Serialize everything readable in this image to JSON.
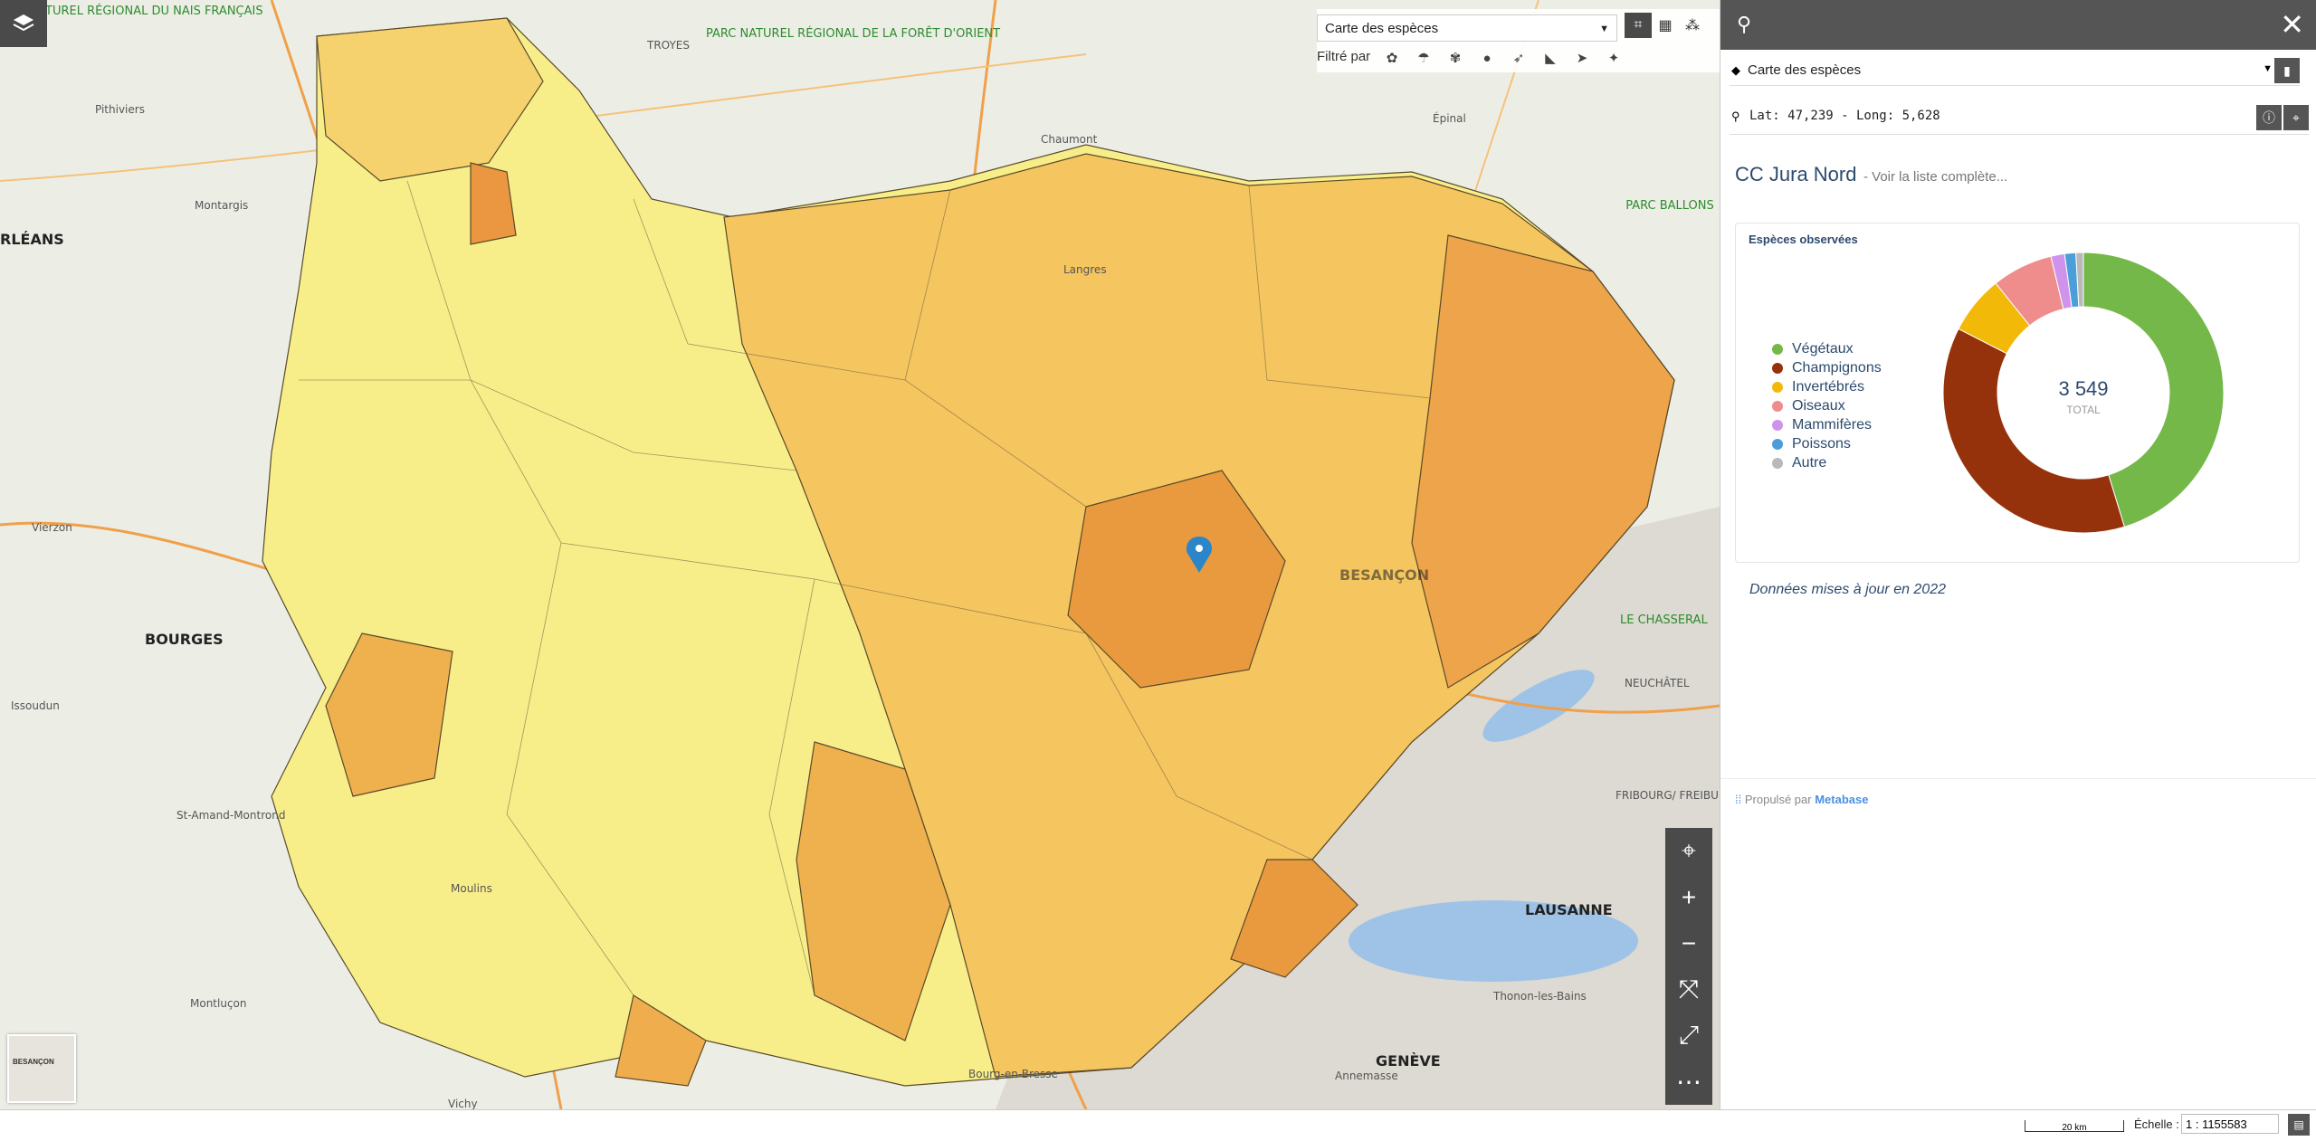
{
  "map": {
    "labels": [
      {
        "name": "label-parc-foret-orient",
        "text": "PARC NATUREL RÉGIONAL DE LA FORÊT D'ORIENT",
        "type": "park"
      },
      {
        "name": "label-parc-morvan",
        "text": "TUREL RÉGIONAL DU NAIS FRANÇAIS",
        "type": "park"
      },
      {
        "name": "label-parc-ballons",
        "text": "PARC BALLONS",
        "type": "park"
      },
      {
        "name": "label-le-chasseral",
        "text": "LE CHASSERAL",
        "type": "park"
      },
      {
        "name": "label-orleans",
        "text": "RLÉANS",
        "type": "big"
      },
      {
        "name": "label-bourges",
        "text": "BOURGES",
        "type": "big"
      },
      {
        "name": "label-lausanne",
        "text": "LAUSANNE",
        "type": "big"
      },
      {
        "name": "label-geneve",
        "text": "GENÈVE",
        "type": "big"
      },
      {
        "name": "label-besancon",
        "text": "BESANÇON",
        "type": "big"
      },
      {
        "name": "label-neuchatel",
        "text": "NEUCHÂTEL",
        "type": "city"
      },
      {
        "name": "label-troyes",
        "text": "TROYES",
        "type": "city"
      },
      {
        "name": "label-chaumont",
        "text": "Chaumont",
        "type": "city"
      },
      {
        "name": "label-epinal",
        "text": "Épinal",
        "type": "city"
      },
      {
        "name": "label-vierzon",
        "text": "Vierzon",
        "type": "city"
      },
      {
        "name": "label-issoudun",
        "text": "Issoudun",
        "type": "city"
      },
      {
        "name": "label-st-amand",
        "text": "St-Amand-Montrond",
        "type": "city"
      },
      {
        "name": "label-moulins",
        "text": "Moulins",
        "type": "city"
      },
      {
        "name": "label-montlucon",
        "text": "Montluçon",
        "type": "city"
      },
      {
        "name": "label-bourg",
        "text": "Bourg-en-Bresse",
        "type": "city"
      },
      {
        "name": "label-fribourg",
        "text": "FRIBOURG/ FREIBURG",
        "type": "city"
      },
      {
        "name": "label-annemasse",
        "text": "Annemasse",
        "type": "city"
      },
      {
        "name": "label-thonon",
        "text": "Thonon-les-Bains",
        "type": "city"
      },
      {
        "name": "label-pithiviers",
        "text": "Pithiviers",
        "type": "city"
      },
      {
        "name": "label-montargis",
        "text": "Montargis",
        "type": "city"
      },
      {
        "name": "label-langres",
        "text": "Langres",
        "type": "city"
      },
      {
        "name": "label-vichy",
        "text": "Vichy",
        "type": "city"
      }
    ],
    "zoom_controls": {
      "locate": "⌖",
      "zoom_in": "+",
      "zoom_out": "−",
      "full_extent": "⤧",
      "fullscreen": "⤢",
      "more": "⋯"
    },
    "minimap_label": "BESANÇON"
  },
  "toolbar": {
    "layer_select": "Carte des espèces",
    "filter_label": "Filtré par",
    "filter_icons": [
      "plant-icon",
      "mushroom-icon",
      "insect-icon",
      "beetle-icon",
      "bird-icon",
      "mammal-icon",
      "fish-icon",
      "other-icon"
    ]
  },
  "panel": {
    "layer_select": "Carte des espèces",
    "coordinates": "Lat: 47,239 - Long: 5,628",
    "area_name": "CC Jura Nord",
    "area_link": "- Voir la liste complète...",
    "card_title": "Espèces observées",
    "total_value": "3 549",
    "total_label": "TOTAL",
    "updated": "Données mises à jour en 2022",
    "powered_prefix": "Propulsé par",
    "powered_brand": "Metabase"
  },
  "chart_data": {
    "type": "pie",
    "title": "Espèces observées",
    "categories": [
      "Végétaux",
      "Champignons",
      "Invertébrés",
      "Oiseaux",
      "Mammifères",
      "Poissons",
      "Autre"
    ],
    "values": [
      1580,
      1300,
      235,
      245,
      55,
      45,
      30
    ],
    "colors": [
      "#74b849",
      "#95320c",
      "#f2b909",
      "#ef8c8c",
      "#cf93ec",
      "#4a9fd9",
      "#b9b9b9"
    ],
    "total": 3549,
    "donut": true
  },
  "footer": {
    "scale_text": "20 km",
    "scale_label": "Échelle :",
    "scale_value": "1 : 1155583"
  }
}
